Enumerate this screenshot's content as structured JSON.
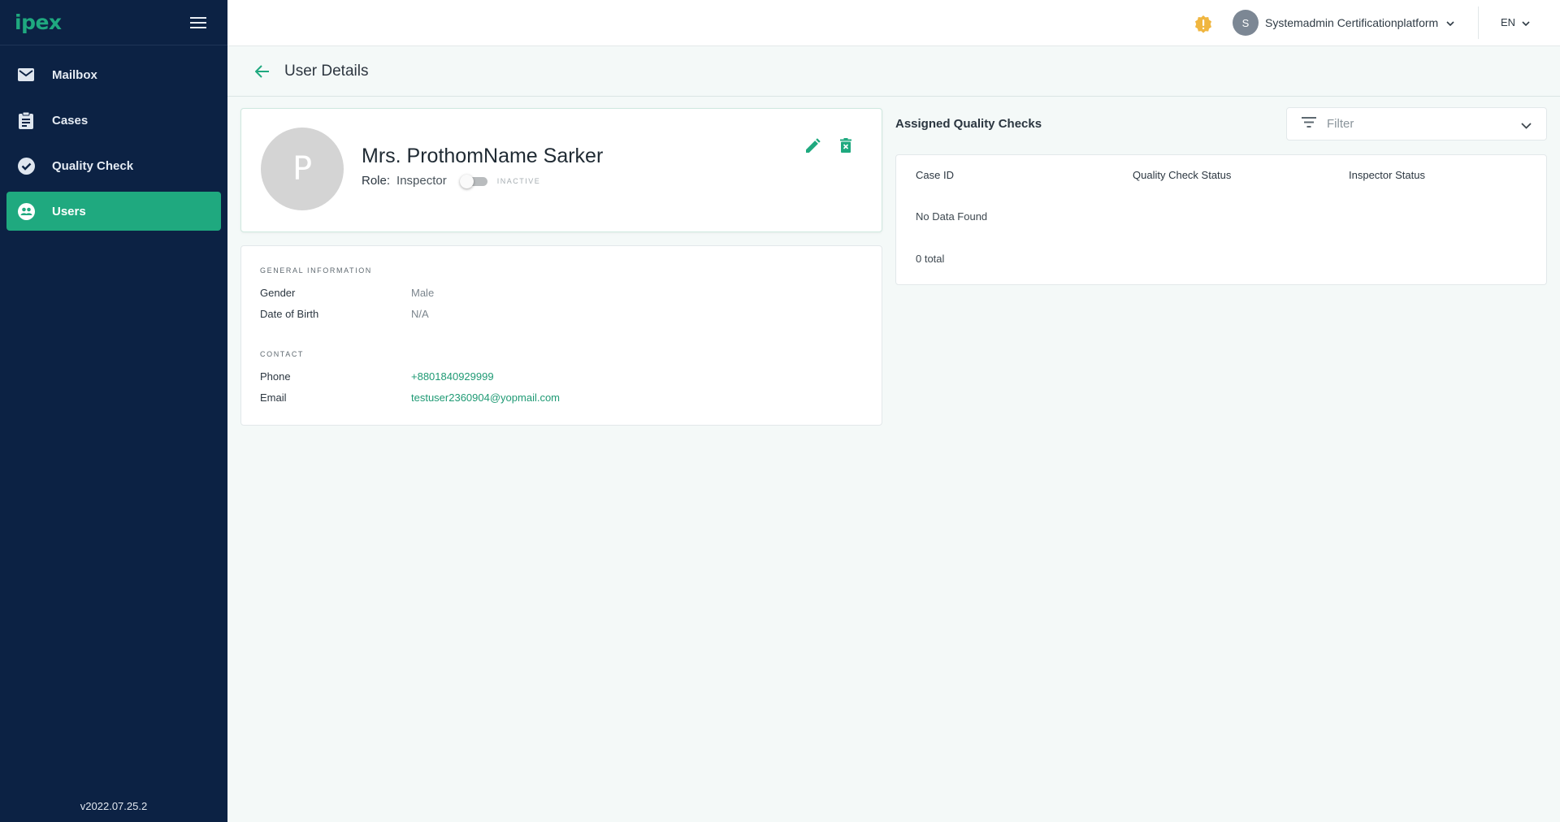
{
  "app": {
    "logo": "ipex",
    "version": "v2022.07.25.2"
  },
  "sidebar": {
    "items": [
      {
        "label": "Mailbox",
        "icon": "mail-icon"
      },
      {
        "label": "Cases",
        "icon": "clipboard-icon"
      },
      {
        "label": "Quality Check",
        "icon": "check-circle-icon"
      },
      {
        "label": "Users",
        "icon": "users-icon",
        "active": true
      }
    ]
  },
  "topbar": {
    "user_initial": "S",
    "user_name": "Systemadmin Certificationplatform",
    "language": "EN"
  },
  "page": {
    "title": "User Details"
  },
  "profile": {
    "initial": "P",
    "name": "Mrs. ProthomName Sarker",
    "role_label": "Role:",
    "role": "Inspector",
    "status": "INACTIVE",
    "active": false
  },
  "general_info": {
    "section": "GENERAL INFORMATION",
    "gender_label": "Gender",
    "gender": "Male",
    "dob_label": "Date of Birth",
    "dob": "N/A"
  },
  "contact": {
    "section": "CONTACT",
    "phone_label": "Phone",
    "phone": "+8801840929999",
    "email_label": "Email",
    "email": "testuser2360904@yopmail.com"
  },
  "assigned": {
    "title": "Assigned Quality Checks",
    "filter_placeholder": "Filter",
    "columns": [
      "Case ID",
      "Quality Check Status",
      "Inspector Status"
    ],
    "empty_text": "No Data Found",
    "total_text": "0 total"
  },
  "colors": {
    "sidebar_bg": "#0c2244",
    "accent": "#1fa97f",
    "page_bg": "#f4f9f8"
  }
}
